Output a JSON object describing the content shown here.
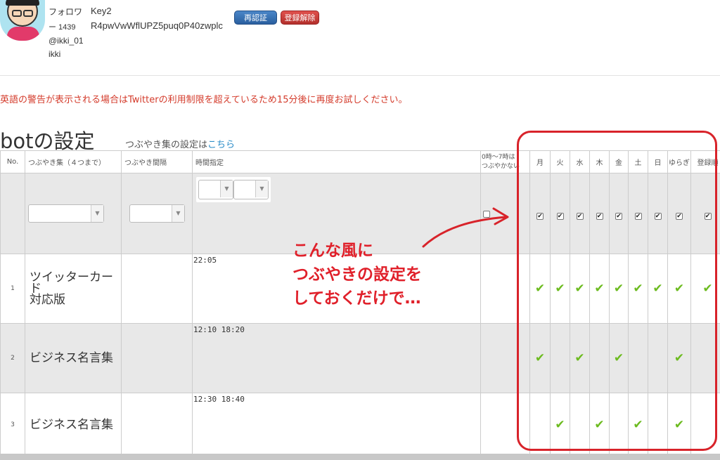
{
  "account": {
    "follower_label": "フォロワ",
    "follower_count": "ー 1439",
    "key_label": "Key2",
    "key_value": "R4pwVwWflUPZ5puq0P40zwplc",
    "handle": "@ikki_01",
    "name": "ikki",
    "reauth_label": "再認証",
    "unregister_label": "登録解除"
  },
  "warning": "英語の警告が表示される場合はTwitterの利用制限を超えているため15分後に再度お試しください。",
  "page_title": "botの設定",
  "tweetset_link": {
    "prefix": "つぶやき集の設定は",
    "link": "こちら"
  },
  "table": {
    "headers": [
      "No.",
      "つぶやき集（４つまで）",
      "つぶやき間隔",
      "時間指定",
      "0時〜7時は\nつぶやかない",
      "月",
      "火",
      "水",
      "木",
      "金",
      "土",
      "日",
      "ゆらぎ",
      "登録順"
    ],
    "rows": [
      {
        "no": "1",
        "name": "ツイッターカード\n対応版",
        "times": "22:05",
        "days": [
          true,
          true,
          true,
          true,
          true,
          true,
          true,
          true,
          true
        ]
      },
      {
        "no": "2",
        "name": "ビジネス名言集",
        "times": "12:10 18:20",
        "days": [
          true,
          false,
          true,
          false,
          true,
          false,
          false,
          true,
          false
        ]
      },
      {
        "no": "3",
        "name": "ビジネス名言集",
        "times": "12:30 18:40",
        "days": [
          false,
          true,
          false,
          true,
          false,
          true,
          false,
          true,
          false
        ]
      }
    ]
  },
  "overlay_text": [
    "こんな風に",
    "つぶやきの設定を",
    "しておくだけで…"
  ],
  "colors": {
    "accent_red": "#d8232a",
    "check_green": "#6cbb1f",
    "link_blue": "#2a8cc8"
  }
}
